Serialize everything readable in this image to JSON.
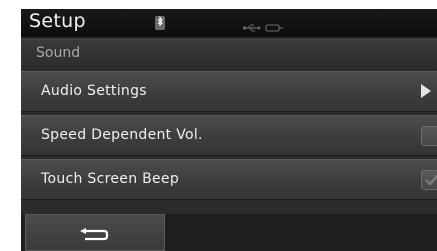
{
  "header": {
    "title": "Setup",
    "status_icons": [
      "bluetooth-icon",
      "usb-icon",
      "aux-icon"
    ]
  },
  "section": {
    "label": "Sound"
  },
  "menu": {
    "items": [
      {
        "label": "Audio Settings",
        "control": "arrow"
      },
      {
        "label": "Speed Dependent Vol.",
        "control": "checkbox",
        "checked": false
      },
      {
        "label": "Touch Screen Beep",
        "control": "checkbox",
        "checked": true
      }
    ]
  },
  "footer": {
    "back_icon": "return-arrow-icon"
  },
  "colors": {
    "background": "#2b2b2b",
    "header_bg": "#111111",
    "text": "#f0f0f0",
    "section_text": "#a9a9a9"
  }
}
